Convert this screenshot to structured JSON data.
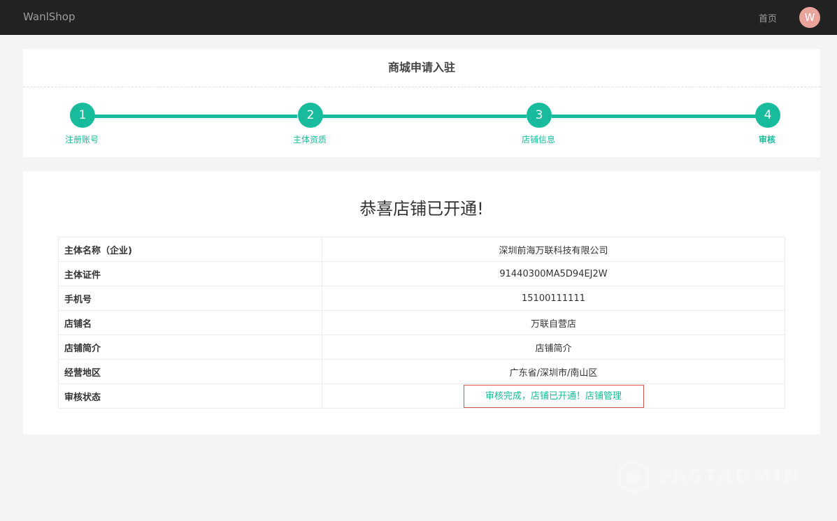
{
  "header": {
    "brand": "WanlShop",
    "nav_home": "首页",
    "avatar_letter": "W"
  },
  "steps_panel": {
    "title": "商城申请入驻",
    "steps": [
      {
        "number": "1",
        "label": "注册账号"
      },
      {
        "number": "2",
        "label": "主体资质"
      },
      {
        "number": "3",
        "label": "店铺信息"
      },
      {
        "number": "4",
        "label": "审核"
      }
    ]
  },
  "result": {
    "heading": "恭喜店铺已开通!",
    "rows": [
      {
        "key": "主体名称（企业)",
        "value": "深圳前海万联科技有限公司"
      },
      {
        "key": "主体证件",
        "value": "91440300MA5D94EJ2W"
      },
      {
        "key": "手机号",
        "value": "15100111111"
      },
      {
        "key": "店铺名",
        "value": "万联自营店"
      },
      {
        "key": "店铺简介",
        "value": "店铺简介"
      },
      {
        "key": "经营地区",
        "value": "广东省/深圳市/南山区"
      },
      {
        "key": "审核状态",
        "status_text": "审核完成，店铺已开通！",
        "status_link": "店铺管理"
      }
    ]
  },
  "watermark": "FASTADMIN",
  "colors": {
    "accent": "#18bc9c",
    "topbar": "#222222",
    "status_border": "#d9534f"
  }
}
